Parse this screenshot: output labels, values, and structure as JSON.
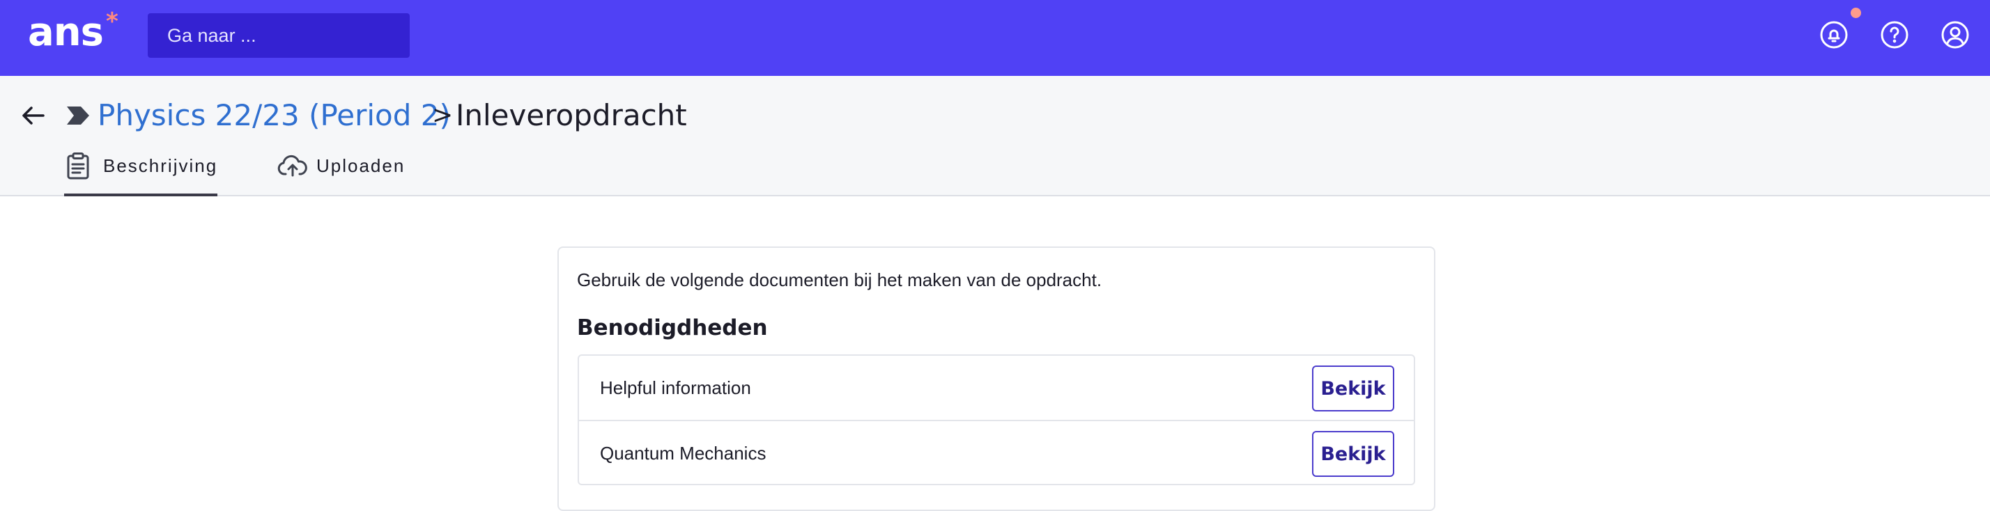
{
  "header": {
    "logo_text": "ans",
    "logo_star": "*",
    "search_placeholder": "Ga naar ...",
    "icons": [
      "notification-bell-icon",
      "help-icon",
      "profile-icon"
    ],
    "colors": {
      "brand": "#5041f5",
      "search_bg": "#3422d2",
      "accent_star": "#ff8a80",
      "notification_dot": "#ff9c8c"
    }
  },
  "breadcrumb": {
    "parent": "Physics 22/23 (Period 2)",
    "separator": ">",
    "current": "Inleveropdracht"
  },
  "tabs": [
    {
      "label": "Beschrijving",
      "icon": "clipboard-icon",
      "active": true
    },
    {
      "label": "Uploaden",
      "icon": "cloud-upload-icon",
      "active": false
    }
  ],
  "main": {
    "intro": "Gebruik de volgende documenten bij het maken van de opdracht.",
    "section_title": "Benodigdheden",
    "items": [
      {
        "label": "Helpful information",
        "button": "Bekijk"
      },
      {
        "label": "Quantum Mechanics",
        "button": "Bekijk"
      }
    ]
  }
}
